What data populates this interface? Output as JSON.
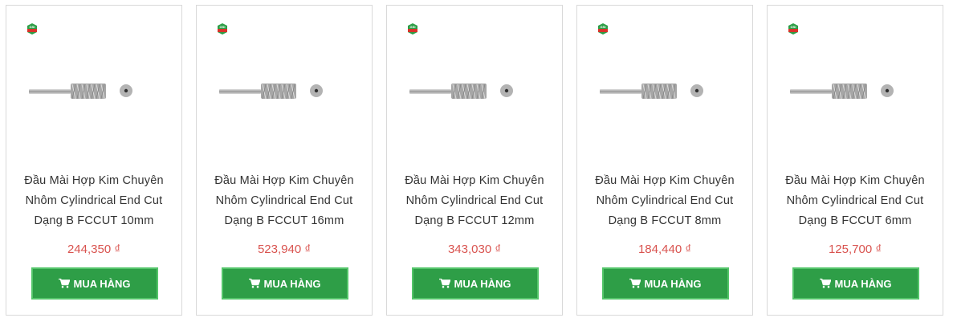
{
  "products": [
    {
      "name": "Đầu Mài Hợp Kim Chuyên Nhôm Cylindrical End Cut Dạng B FCCUT 10mm",
      "price": "244,350 ₫",
      "button": "MUA HÀNG",
      "logo": "GSI TOOLS"
    },
    {
      "name": "Đầu Mài Hợp Kim Chuyên Nhôm Cylindrical End Cut Dạng B FCCUT 16mm",
      "price": "523,940 ₫",
      "button": "MUA HÀNG",
      "logo": "GSI TOOLS"
    },
    {
      "name": "Đầu Mài Hợp Kim Chuyên Nhôm Cylindrical End Cut Dạng B FCCUT 12mm",
      "price": "343,030 ₫",
      "button": "MUA HÀNG",
      "logo": "GSI TOOLS"
    },
    {
      "name": "Đầu Mài Hợp Kim Chuyên Nhôm Cylindrical End Cut Dạng B FCCUT 8mm",
      "price": "184,440 ₫",
      "button": "MUA HÀNG",
      "logo": "GSI TOOLS"
    },
    {
      "name": "Đầu Mài Hợp Kim Chuyên Nhôm Cylindrical End Cut Dạng B FCCUT 6mm",
      "price": "125,700 ₫",
      "button": "MUA HÀNG",
      "logo": "GSI TOOLS"
    }
  ],
  "icons": {
    "cart": "cart-icon",
    "logo": "gsi-logo-icon",
    "product_image": "burr-tool-image"
  },
  "colors": {
    "price": "#d9534f",
    "button": "#2e9e47",
    "button_border": "#54c56a"
  }
}
